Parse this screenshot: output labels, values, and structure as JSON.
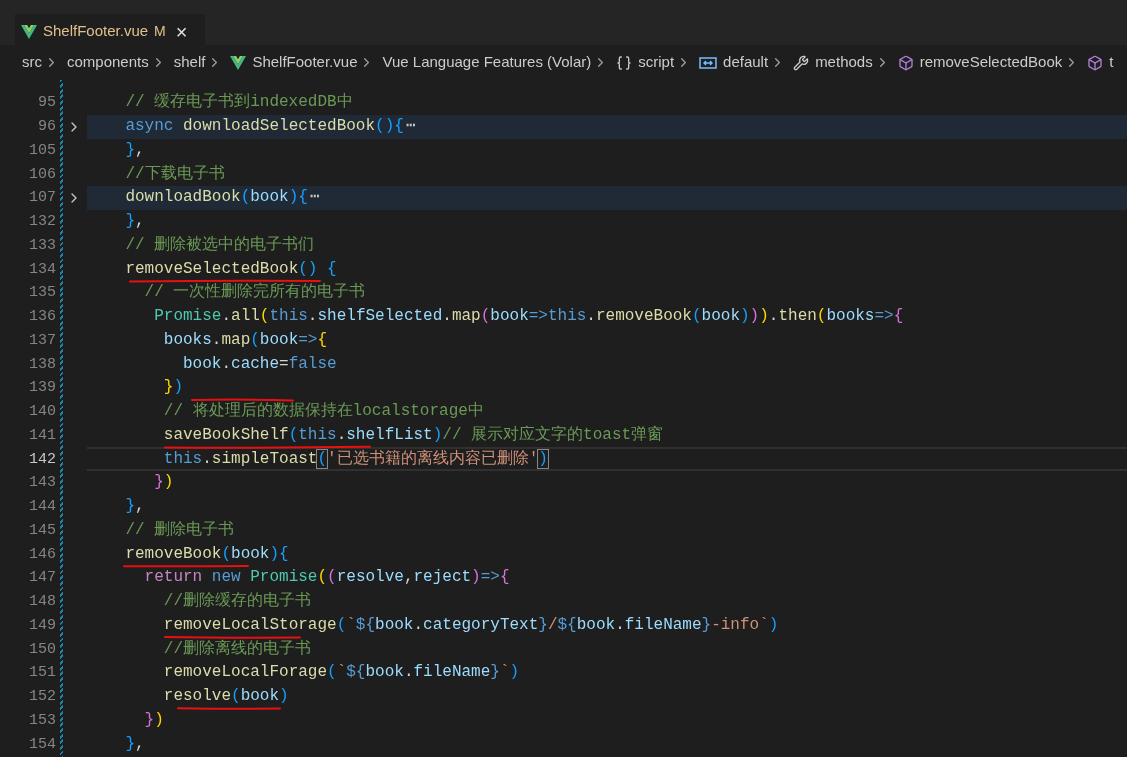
{
  "tab": {
    "title": "ShelfFooter.vue",
    "status": "M",
    "close": "×",
    "selected": true
  },
  "breadcrumbs": [
    {
      "kind": "plain",
      "label": "src"
    },
    {
      "kind": "plain",
      "label": "components"
    },
    {
      "kind": "plain",
      "label": "shelf"
    },
    {
      "kind": "vue",
      "label": "ShelfFooter.vue"
    },
    {
      "kind": "plain",
      "label": "Vue Language Features (Volar)"
    },
    {
      "kind": "braces",
      "label": "script"
    },
    {
      "kind": "module",
      "label": "default"
    },
    {
      "kind": "wrench",
      "label": "methods"
    },
    {
      "kind": "cube",
      "label": "removeSelectedBook"
    },
    {
      "kind": "cube",
      "label": "t"
    }
  ],
  "lines": [
    {
      "number": "95",
      "folded": false,
      "current": false,
      "tokens": [
        {
          "kind": "comment",
          "text": "    // 缓存电子书到indexedDB中"
        }
      ]
    },
    {
      "number": "96",
      "folded": true,
      "current": false,
      "fold_mark": "⋯",
      "tokens": [
        {
          "kind": "keyword",
          "text": "    async "
        },
        {
          "kind": "func",
          "text": "downloadSelectedBook"
        },
        {
          "kind": "b3",
          "text": "(){"
        }
      ]
    },
    {
      "number": "105",
      "folded": false,
      "current": false,
      "tokens": [
        {
          "kind": "b3",
          "text": "    }"
        },
        {
          "kind": "plain",
          "text": ","
        }
      ]
    },
    {
      "number": "106",
      "folded": false,
      "current": false,
      "tokens": [
        {
          "kind": "comment",
          "text": "    //下载电子书"
        }
      ]
    },
    {
      "number": "107",
      "folded": true,
      "current": false,
      "fold_mark": "⋯",
      "tokens": [
        {
          "kind": "func",
          "text": "    downloadBook"
        },
        {
          "kind": "b3",
          "text": "("
        },
        {
          "kind": "var",
          "text": "book"
        },
        {
          "kind": "b3",
          "text": "){"
        }
      ]
    },
    {
      "number": "132",
      "folded": false,
      "current": false,
      "tokens": [
        {
          "kind": "b3",
          "text": "    }"
        },
        {
          "kind": "plain",
          "text": ","
        }
      ]
    },
    {
      "number": "133",
      "folded": false,
      "current": false,
      "tokens": [
        {
          "kind": "comment",
          "text": "    // 删除被选中的电子书们"
        }
      ]
    },
    {
      "number": "134",
      "folded": false,
      "current": false,
      "tokens": [
        {
          "kind": "func",
          "text": "    removeSelectedBook"
        },
        {
          "kind": "b3",
          "text": "() {"
        }
      ]
    },
    {
      "number": "135",
      "folded": false,
      "current": false,
      "tokens": [
        {
          "kind": "comment",
          "text": "      // 一次性删除完所有的电子书"
        }
      ]
    },
    {
      "number": "136",
      "folded": false,
      "current": false,
      "tokens": [
        {
          "kind": "class",
          "text": "       Promise"
        },
        {
          "kind": "plain",
          "text": "."
        },
        {
          "kind": "func",
          "text": "all"
        },
        {
          "kind": "b1",
          "text": "("
        },
        {
          "kind": "keyword",
          "text": "this"
        },
        {
          "kind": "plain",
          "text": "."
        },
        {
          "kind": "var",
          "text": "shelfSelected"
        },
        {
          "kind": "plain",
          "text": "."
        },
        {
          "kind": "func",
          "text": "map"
        },
        {
          "kind": "b2",
          "text": "("
        },
        {
          "kind": "var",
          "text": "book"
        },
        {
          "kind": "keyword",
          "text": "=>"
        },
        {
          "kind": "keyword",
          "text": "this"
        },
        {
          "kind": "plain",
          "text": "."
        },
        {
          "kind": "func",
          "text": "removeBook"
        },
        {
          "kind": "b3",
          "text": "("
        },
        {
          "kind": "var",
          "text": "book"
        },
        {
          "kind": "b3",
          "text": ")"
        },
        {
          "kind": "b2",
          "text": ")"
        },
        {
          "kind": "b1",
          "text": ")"
        },
        {
          "kind": "plain",
          "text": "."
        },
        {
          "kind": "func",
          "text": "then"
        },
        {
          "kind": "b1",
          "text": "("
        },
        {
          "kind": "var",
          "text": "books"
        },
        {
          "kind": "keyword",
          "text": "=>"
        },
        {
          "kind": "b2",
          "text": "{"
        }
      ]
    },
    {
      "number": "137",
      "folded": false,
      "current": false,
      "tokens": [
        {
          "kind": "var",
          "text": "        books"
        },
        {
          "kind": "plain",
          "text": "."
        },
        {
          "kind": "func",
          "text": "map"
        },
        {
          "kind": "b3",
          "text": "("
        },
        {
          "kind": "var",
          "text": "book"
        },
        {
          "kind": "keyword",
          "text": "=>"
        },
        {
          "kind": "b1",
          "text": "{"
        }
      ]
    },
    {
      "number": "138",
      "folded": false,
      "current": false,
      "tokens": [
        {
          "kind": "var",
          "text": "          book"
        },
        {
          "kind": "plain",
          "text": "."
        },
        {
          "kind": "var",
          "text": "cache"
        },
        {
          "kind": "plain",
          "text": "="
        },
        {
          "kind": "keyword",
          "text": "false"
        }
      ]
    },
    {
      "number": "139",
      "folded": false,
      "current": false,
      "tokens": [
        {
          "kind": "b1",
          "text": "        }"
        },
        {
          "kind": "b3",
          "text": ")"
        }
      ]
    },
    {
      "number": "140",
      "folded": false,
      "current": false,
      "tokens": [
        {
          "kind": "comment",
          "text": "        // 将处理后的数据保持在localstorage中"
        }
      ]
    },
    {
      "number": "141",
      "folded": false,
      "current": false,
      "tokens": [
        {
          "kind": "func",
          "text": "        saveBookShelf"
        },
        {
          "kind": "b3",
          "text": "("
        },
        {
          "kind": "keyword",
          "text": "this"
        },
        {
          "kind": "plain",
          "text": "."
        },
        {
          "kind": "var",
          "text": "shelfList"
        },
        {
          "kind": "b3",
          "text": ")"
        },
        {
          "kind": "comment",
          "text": "// 展示对应文字的toast弹窗"
        }
      ]
    },
    {
      "number": "142",
      "folded": false,
      "current": true,
      "tokens": [
        {
          "kind": "keyword",
          "text": "        this"
        },
        {
          "kind": "plain",
          "text": "."
        },
        {
          "kind": "func",
          "text": "simpleToast"
        },
        {
          "kind": "b3m",
          "text": "("
        },
        {
          "kind": "string",
          "text": "'已选书籍的离线内容已删除'"
        },
        {
          "kind": "b3m",
          "text": ")"
        }
      ]
    },
    {
      "number": "143",
      "folded": false,
      "current": false,
      "tokens": [
        {
          "kind": "b2",
          "text": "       }"
        },
        {
          "kind": "b1",
          "text": ")"
        }
      ]
    },
    {
      "number": "144",
      "folded": false,
      "current": false,
      "tokens": [
        {
          "kind": "b3",
          "text": "    }"
        },
        {
          "kind": "plain",
          "text": ","
        }
      ]
    },
    {
      "number": "145",
      "folded": false,
      "current": false,
      "tokens": [
        {
          "kind": "comment",
          "text": "    // 删除电子书"
        }
      ]
    },
    {
      "number": "146",
      "folded": false,
      "current": false,
      "tokens": [
        {
          "kind": "func",
          "text": "    removeBook"
        },
        {
          "kind": "b3",
          "text": "("
        },
        {
          "kind": "var",
          "text": "book"
        },
        {
          "kind": "b3",
          "text": "){"
        }
      ]
    },
    {
      "number": "147",
      "folded": false,
      "current": false,
      "tokens": [
        {
          "kind": "control",
          "text": "      return "
        },
        {
          "kind": "keyword",
          "text": "new "
        },
        {
          "kind": "class",
          "text": "Promise"
        },
        {
          "kind": "b1",
          "text": "("
        },
        {
          "kind": "b2",
          "text": "("
        },
        {
          "kind": "var",
          "text": "resolve"
        },
        {
          "kind": "plain",
          "text": ","
        },
        {
          "kind": "var",
          "text": "reject"
        },
        {
          "kind": "b2",
          "text": ")"
        },
        {
          "kind": "keyword",
          "text": "=>"
        },
        {
          "kind": "b2",
          "text": "{"
        }
      ]
    },
    {
      "number": "148",
      "folded": false,
      "current": false,
      "tokens": [
        {
          "kind": "comment",
          "text": "        //删除缓存的电子书"
        }
      ]
    },
    {
      "number": "149",
      "folded": false,
      "current": false,
      "tokens": [
        {
          "kind": "func",
          "text": "        removeLocalStorage"
        },
        {
          "kind": "b3",
          "text": "("
        },
        {
          "kind": "string",
          "text": "`"
        },
        {
          "kind": "keyword",
          "text": "${"
        },
        {
          "kind": "var",
          "text": "book"
        },
        {
          "kind": "plain",
          "text": "."
        },
        {
          "kind": "var",
          "text": "categoryText"
        },
        {
          "kind": "keyword",
          "text": "}"
        },
        {
          "kind": "string",
          "text": "/"
        },
        {
          "kind": "keyword",
          "text": "${"
        },
        {
          "kind": "var",
          "text": "book"
        },
        {
          "kind": "plain",
          "text": "."
        },
        {
          "kind": "var",
          "text": "fileName"
        },
        {
          "kind": "keyword",
          "text": "}"
        },
        {
          "kind": "string",
          "text": "-info`"
        },
        {
          "kind": "b3",
          "text": ")"
        }
      ]
    },
    {
      "number": "150",
      "folded": false,
      "current": false,
      "tokens": [
        {
          "kind": "comment",
          "text": "        //删除离线的电子书"
        }
      ]
    },
    {
      "number": "151",
      "folded": false,
      "current": false,
      "tokens": [
        {
          "kind": "func",
          "text": "        removeLocalForage"
        },
        {
          "kind": "b3",
          "text": "("
        },
        {
          "kind": "string",
          "text": "`"
        },
        {
          "kind": "keyword",
          "text": "${"
        },
        {
          "kind": "var",
          "text": "book"
        },
        {
          "kind": "plain",
          "text": "."
        },
        {
          "kind": "var",
          "text": "fileName"
        },
        {
          "kind": "keyword",
          "text": "}"
        },
        {
          "kind": "string",
          "text": "`"
        },
        {
          "kind": "b3",
          "text": ")"
        }
      ]
    },
    {
      "number": "152",
      "folded": false,
      "current": false,
      "tokens": [
        {
          "kind": "func",
          "text": "        resolve"
        },
        {
          "kind": "b3",
          "text": "("
        },
        {
          "kind": "var",
          "text": "book"
        },
        {
          "kind": "b3",
          "text": ")"
        }
      ]
    },
    {
      "number": "153",
      "folded": false,
      "current": false,
      "tokens": [
        {
          "kind": "b2",
          "text": "      }"
        },
        {
          "kind": "b1",
          "text": ")"
        }
      ]
    },
    {
      "number": "154",
      "folded": false,
      "current": false,
      "tokens": [
        {
          "kind": "b3",
          "text": "    }"
        },
        {
          "kind": "plain",
          "text": ","
        }
      ]
    }
  ]
}
